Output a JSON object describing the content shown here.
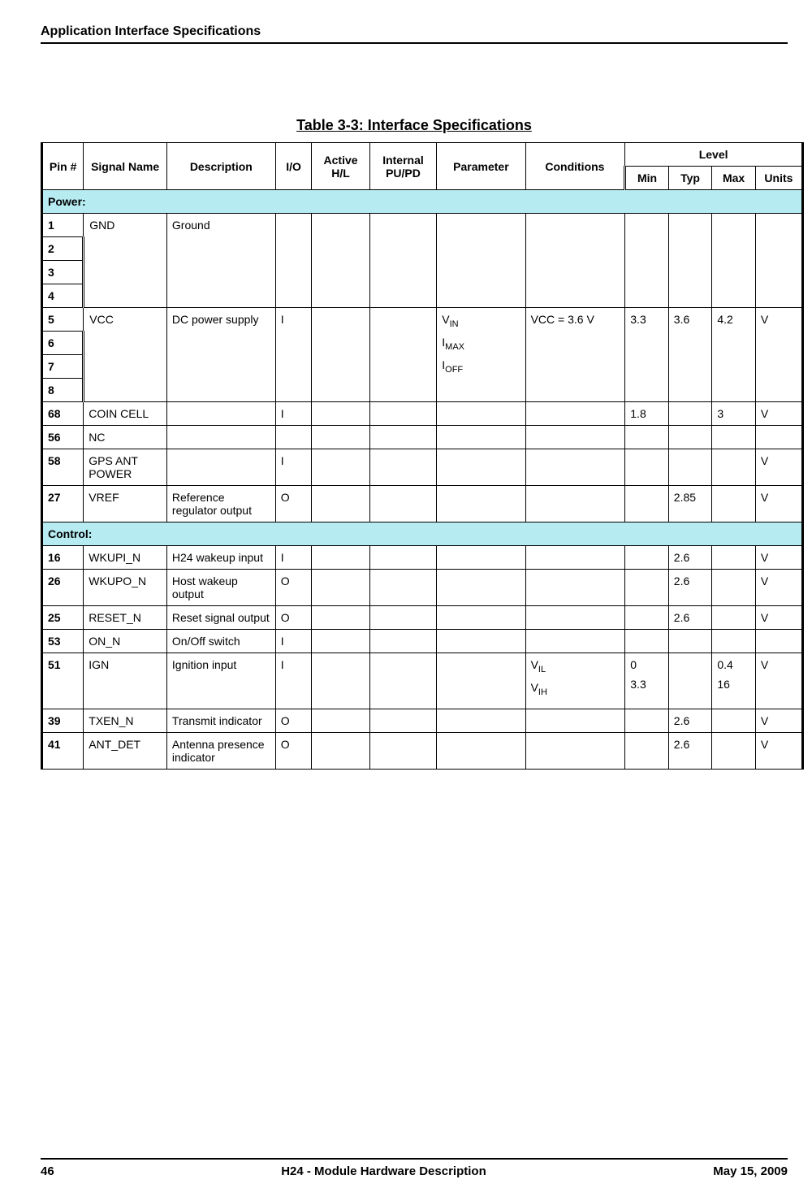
{
  "header_title": "Application Interface Specifications",
  "table_title": "Table 3-3: Interface Specifications",
  "columns": {
    "pin": "Pin #",
    "signal": "Signal Name",
    "desc": "Description",
    "io": "I/O",
    "active": "Active H/L",
    "pupd": "Internal PU/PD",
    "param": "Parameter",
    "cond": "Conditions",
    "level": "Level",
    "min": "Min",
    "typ": "Typ",
    "max": "Max",
    "units": "Units"
  },
  "sections": {
    "power": "Power:",
    "control": "Control:"
  },
  "rows": {
    "gnd": {
      "pins": [
        "1",
        "2",
        "3",
        "4"
      ],
      "signal": "GND",
      "desc": "Ground"
    },
    "vcc": {
      "pins": [
        "5",
        "6",
        "7",
        "8"
      ],
      "signal": "VCC",
      "desc": "DC power supply",
      "io": "I",
      "param_vin": "V",
      "param_vin_sub": "IN",
      "param_imax": "I",
      "param_imax_sub": "MAX",
      "param_ioff": "I",
      "param_ioff_sub": "OFF",
      "cond": "VCC = 3.6 V",
      "min": "3.3",
      "typ": "3.6",
      "max": "4.2",
      "units": "V"
    },
    "coincell": {
      "pin": "68",
      "signal": "COIN CELL",
      "io": "I",
      "min": "1.8",
      "max": "3",
      "units": "V"
    },
    "nc": {
      "pin": "56",
      "signal": "NC"
    },
    "gpsant": {
      "pin": "58",
      "signal": "GPS ANT POWER",
      "io": "I",
      "units": "V"
    },
    "vref": {
      "pin": "27",
      "signal": "VREF",
      "desc": "Reference regulator out­put",
      "io": "O",
      "typ": "2.85",
      "units": "V"
    },
    "wkupi": {
      "pin": "16",
      "signal": "WKUPI_N",
      "desc": "H24 wakeup input",
      "io": "I",
      "typ": "2.6",
      "units": "V"
    },
    "wkupo": {
      "pin": "26",
      "signal": "WKUPO_N",
      "desc": "Host wakeup output",
      "io": "O",
      "typ": "2.6",
      "units": "V"
    },
    "reset": {
      "pin": "25",
      "signal": "RESET_N",
      "desc": "Reset signal output",
      "io": "O",
      "typ": "2.6",
      "units": "V"
    },
    "onn": {
      "pin": "53",
      "signal": "ON_N",
      "desc": "On/Off switch",
      "io": "I"
    },
    "ign": {
      "pin": "51",
      "signal": "IGN",
      "desc": "Ignition input",
      "io": "I",
      "cond_vil": "V",
      "cond_vil_sub": "IL",
      "cond_vih": "V",
      "cond_vih_sub": "IH",
      "min_vil": "0",
      "min_vih": "3.3",
      "max_vil": "0.4",
      "max_vih": "16",
      "units": "V"
    },
    "txen": {
      "pin": "39",
      "signal": "TXEN_N",
      "desc": "Transmit indi­cator",
      "io": "O",
      "typ": "2.6",
      "units": "V"
    },
    "antdet": {
      "pin": "41",
      "signal": "ANT_DET",
      "desc": "Antenna pres­ence indicator",
      "io": "O",
      "typ": "2.6",
      "units": "V"
    }
  },
  "footer": {
    "page": "46",
    "doc": "H24 - Module Hardware Description",
    "date": "May 15, 2009"
  }
}
